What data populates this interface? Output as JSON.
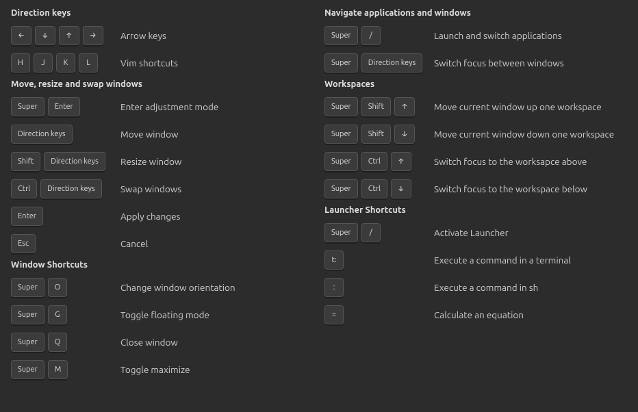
{
  "left": [
    {
      "title": "Direction keys",
      "rows": [
        {
          "keys": [
            "←",
            "↓",
            "↑",
            "→"
          ],
          "desc": "Arrow keys"
        },
        {
          "keys": [
            "H",
            "J",
            "K",
            "L"
          ],
          "desc": "Vim shortcuts"
        }
      ]
    },
    {
      "title": "Move, resize and swap windows",
      "rows": [
        {
          "keys": [
            "Super",
            "Enter"
          ],
          "desc": "Enter adjustment mode"
        },
        {
          "keys": [
            "Direction keys"
          ],
          "desc": "Move window"
        },
        {
          "keys": [
            "Shift",
            "Direction keys"
          ],
          "desc": "Resize window"
        },
        {
          "keys": [
            "Ctrl",
            "Direction keys"
          ],
          "desc": "Swap windows"
        },
        {
          "keys": [
            "Enter"
          ],
          "desc": "Apply changes"
        },
        {
          "keys": [
            "Esc"
          ],
          "desc": "Cancel"
        }
      ]
    },
    {
      "title": "Window Shortcuts",
      "rows": [
        {
          "keys": [
            "Super",
            "O"
          ],
          "desc": "Change window orientation"
        },
        {
          "keys": [
            "Super",
            "G"
          ],
          "desc": "Toggle floating mode"
        },
        {
          "keys": [
            "Super",
            "Q"
          ],
          "desc": "Close window"
        },
        {
          "keys": [
            "Super",
            "M"
          ],
          "desc": "Toggle maximize"
        }
      ]
    }
  ],
  "right": [
    {
      "title": "Navigate applications and windows",
      "rows": [
        {
          "keys": [
            "Super",
            "/"
          ],
          "desc": "Launch and switch applications"
        },
        {
          "keys": [
            "Super",
            "Direction keys"
          ],
          "desc": "Switch focus between windows"
        }
      ]
    },
    {
      "title": "Workspaces",
      "rows": [
        {
          "keys": [
            "Super",
            "Shift",
            "↑"
          ],
          "desc": "Move current window up one workspace"
        },
        {
          "keys": [
            "Super",
            "Shift",
            "↓"
          ],
          "desc": "Move current window down one workspace"
        },
        {
          "keys": [
            "Super",
            "Ctrl",
            "↑"
          ],
          "desc": "Switch focus to the worksapce above"
        },
        {
          "keys": [
            "Super",
            "Ctrl",
            "↓"
          ],
          "desc": "Switch focus to the workspace below"
        }
      ]
    },
    {
      "title": "Launcher Shortcuts",
      "rows": [
        {
          "keys": [
            "Super",
            "/"
          ],
          "desc": "Activate Launcher"
        },
        {
          "keys": [
            "t:"
          ],
          "desc": "Execute a command in a terminal"
        },
        {
          "keys": [
            ":"
          ],
          "desc": "Execute a command in sh"
        },
        {
          "keys": [
            "="
          ],
          "desc": "Calculate an equation"
        }
      ]
    }
  ]
}
